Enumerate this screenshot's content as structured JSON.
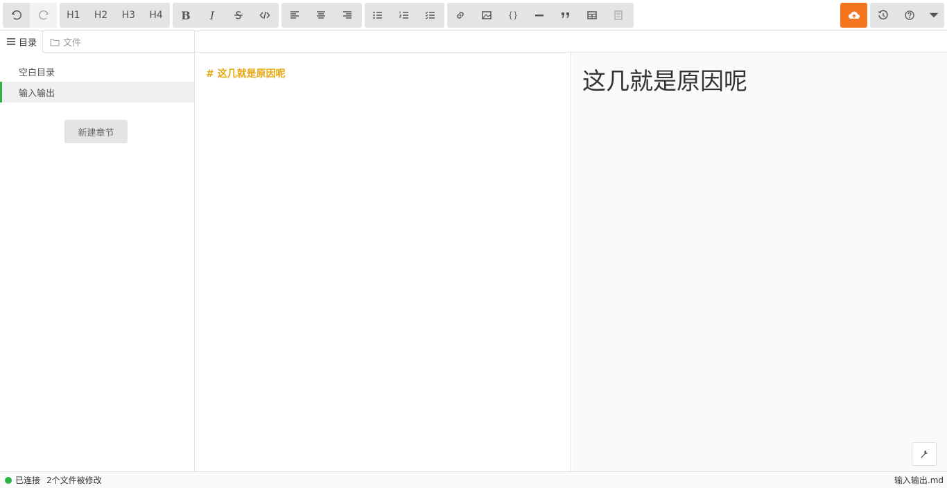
{
  "toolbar": {
    "headings": [
      "H1",
      "H2",
      "H3",
      "H4"
    ],
    "bold": "B",
    "italic": "I"
  },
  "sidebar": {
    "tabs": [
      {
        "label": "目录",
        "icon": "list-icon"
      },
      {
        "label": "文件",
        "icon": "folder-icon"
      }
    ],
    "items": [
      {
        "label": "空白目录"
      },
      {
        "label": "输入输出"
      }
    ],
    "new_chapter_label": "新建章节"
  },
  "editor": {
    "content": "# 这几就是原因呢"
  },
  "preview": {
    "heading": "这几就是原因呢"
  },
  "status": {
    "connection": "已连接",
    "modified": "2个文件被修改",
    "filename": "输入输出.md"
  },
  "colors": {
    "accent": "#f5751f",
    "connected": "#2fb344",
    "markdown_heading": "#e6a70f"
  }
}
